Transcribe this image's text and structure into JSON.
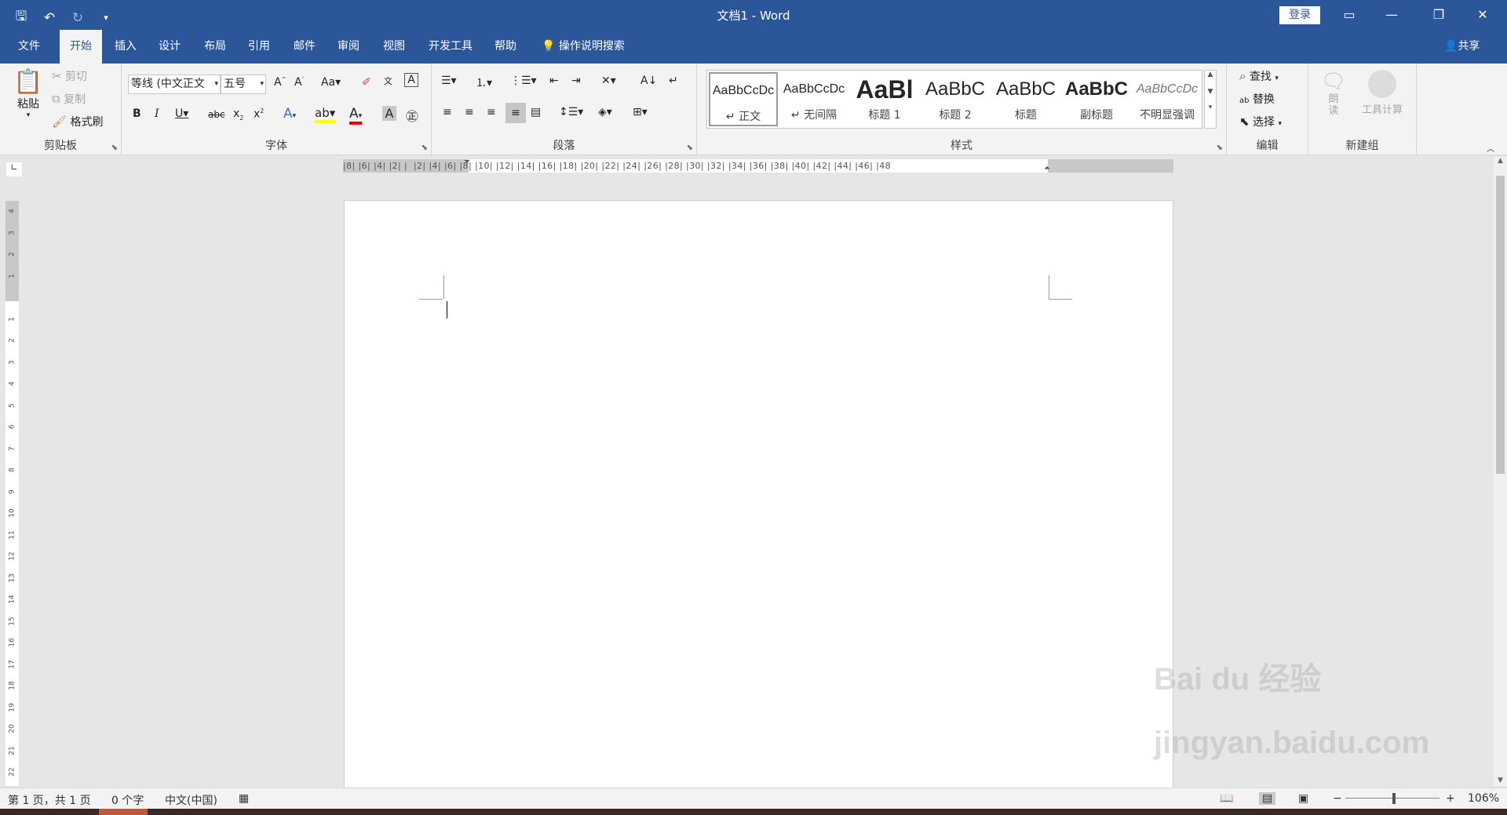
{
  "titlebar": {
    "title": "文档1  -  Word",
    "login": "登录"
  },
  "tabs": [
    "文件",
    "开始",
    "插入",
    "设计",
    "布局",
    "引用",
    "邮件",
    "审阅",
    "视图",
    "开发工具",
    "帮助"
  ],
  "tellme": "操作说明搜索",
  "share": "共享",
  "clipboard": {
    "paste": "粘贴",
    "cut": "剪切",
    "copy": "复制",
    "painter": "格式刷",
    "label": "剪贴板"
  },
  "font": {
    "name": "等线 (中文正文",
    "size": "五号",
    "label": "字体"
  },
  "paragraph": {
    "label": "段落"
  },
  "styles": {
    "label": "样式",
    "items": [
      {
        "preview": "AaBbCcDc",
        "name": "↵ 正文"
      },
      {
        "preview": "AaBbCcDc",
        "name": "↵ 无间隔"
      },
      {
        "preview": "AaBl",
        "name": "标题 1"
      },
      {
        "preview": "AaBbC",
        "name": "标题 2"
      },
      {
        "preview": "AaBbC",
        "name": "标题"
      },
      {
        "preview": "AaBbC",
        "name": "副标题"
      },
      {
        "preview": "AaBbCcDc",
        "name": "不明显强调"
      }
    ]
  },
  "editing": {
    "find": "查找",
    "replace": "替换",
    "select": "选择",
    "label": "编辑"
  },
  "newgroup": {
    "read": "朗读",
    "calc": "工具计算",
    "label": "新建组"
  },
  "ruler_h": "|8| |6| |4| |2| |  |2| |4| |6| |8| |10| |12| |14| |16| |18| |20| |22| |24| |26| |28| |30| |32| |34| |36| |38| |40| |42| |44| |46| |48",
  "status": {
    "page": "第 1 页，共 1 页",
    "words": "0 个字",
    "lang": "中文(中国)",
    "zoom": "106%"
  },
  "watermark": "Bai du 经验 jingyan.baidu.com"
}
